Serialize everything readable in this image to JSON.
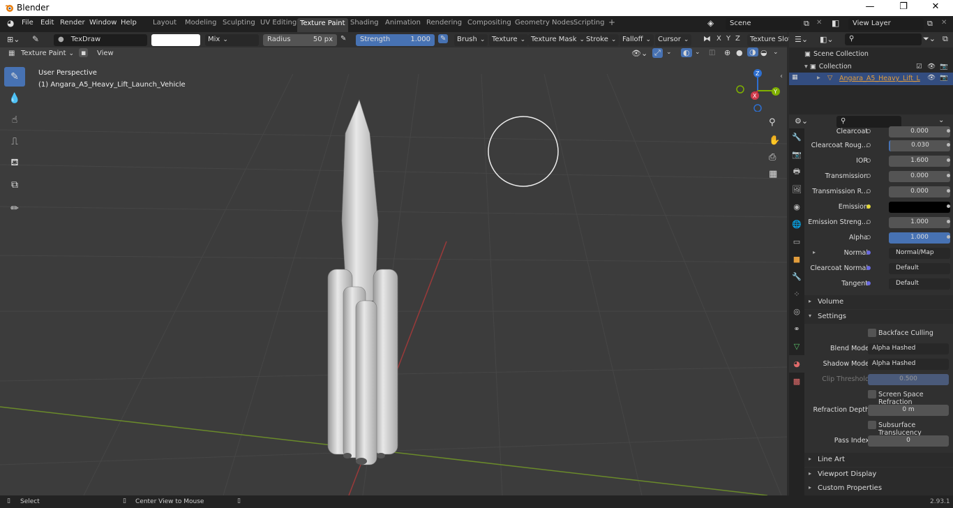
{
  "window": {
    "title": "Blender"
  },
  "menu": {
    "items": [
      "File",
      "Edit",
      "Render",
      "Window",
      "Help"
    ]
  },
  "workspaces": [
    "Layout",
    "Modeling",
    "Sculpting",
    "UV Editing",
    "Texture Paint",
    "Shading",
    "Animation",
    "Rendering",
    "Compositing",
    "Geometry Nodes",
    "Scripting"
  ],
  "active_workspace": "Texture Paint",
  "scene": {
    "label": "Scene",
    "view_layer": "View Layer"
  },
  "tool_header": {
    "brush_name": "TexDraw",
    "blend": "Mix",
    "radius_label": "Radius",
    "radius_value": "50 px",
    "strength_label": "Strength",
    "strength_value": "1.000",
    "menus": [
      "Brush",
      "Texture",
      "Texture Mask",
      "Stroke",
      "Falloff",
      "Cursor"
    ],
    "axes": [
      "X",
      "Y",
      "Z"
    ],
    "texture_slots": "Texture Slots"
  },
  "view_header": {
    "mode": "Texture Paint",
    "view": "View"
  },
  "viewport": {
    "perspective": "User Perspective",
    "object_info": "(1) Angara_A5_Heavy_Lift_Launch_Vehicle",
    "gizmo_axes": [
      "Z",
      "Y",
      "X"
    ]
  },
  "outliner": {
    "scene_collection": "Scene Collection",
    "collection": "Collection",
    "object": "Angara_A5_Heavy_Lift_L"
  },
  "properties": {
    "rows": [
      {
        "label": "Clearcoat",
        "value": "0.000"
      },
      {
        "label": "Clearcoat Roug...",
        "value": "0.030"
      },
      {
        "label": "IOR",
        "value": "1.600"
      },
      {
        "label": "Transmission",
        "value": "0.000"
      },
      {
        "label": "Transmission R...",
        "value": "0.000"
      },
      {
        "label": "Emission",
        "value": ""
      },
      {
        "label": "Emission Streng...",
        "value": "1.000"
      },
      {
        "label": "Alpha",
        "value": "1.000"
      },
      {
        "label": "Normal",
        "value": "Normal/Map"
      },
      {
        "label": "Clearcoat Normal",
        "value": "Default"
      },
      {
        "label": "Tangent",
        "value": "Default"
      }
    ],
    "sections": {
      "volume": "Volume",
      "settings": "Settings",
      "line_art": "Line Art",
      "viewport_display": "Viewport Display",
      "custom_properties": "Custom Properties"
    },
    "settings": {
      "backface_culling": "Backface Culling",
      "blend_mode_label": "Blend Mode",
      "blend_mode": "Alpha Hashed",
      "shadow_mode_label": "Shadow Mode",
      "shadow_mode": "Alpha Hashed",
      "clip_threshold_label": "Clip Threshold",
      "clip_threshold": "0.500",
      "screen_space_refraction": "Screen Space Refraction",
      "refraction_depth_label": "Refraction Depth",
      "refraction_depth": "0 m",
      "subsurface_translucency": "Subsurface Translucency",
      "pass_index_label": "Pass Index",
      "pass_index": "0"
    }
  },
  "status": {
    "select": "Select",
    "center_view": "Center View to Mouse",
    "version": "2.93.1"
  },
  "colors": {
    "accent": "#4772b3",
    "selected_row": "#334d80",
    "object_name": "#e29d3c"
  }
}
